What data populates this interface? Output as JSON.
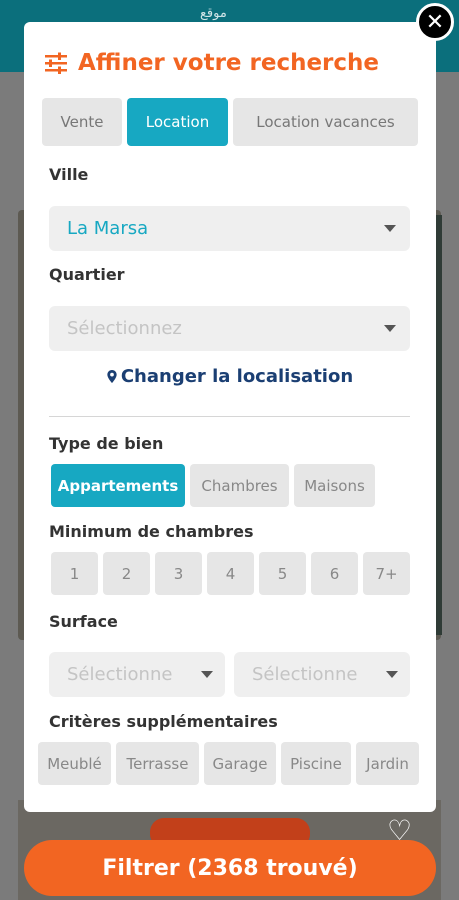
{
  "background": {
    "logo_text": "موقع"
  },
  "modal": {
    "title": "Affiner votre recherche",
    "title_icon": "sliders-icon",
    "accent": "#f26522",
    "active_color": "#17a8c2"
  },
  "tabs": [
    {
      "label": "Vente",
      "active": false
    },
    {
      "label": "Location",
      "active": true
    },
    {
      "label": "Location vacances",
      "active": false
    }
  ],
  "ville": {
    "label": "Ville",
    "value": "La Marsa"
  },
  "quartier": {
    "label": "Quartier",
    "placeholder": "Sélectionnez"
  },
  "change_location": {
    "label": "Changer la localisation",
    "icon": "map-pin-icon"
  },
  "type_de_bien": {
    "label": "Type de bien",
    "options": [
      {
        "label": "Appartements",
        "active": true
      },
      {
        "label": "Chambres",
        "active": false
      },
      {
        "label": "Maisons",
        "active": false
      }
    ]
  },
  "min_chambres": {
    "label": "Minimum de chambres",
    "options": [
      "1",
      "2",
      "3",
      "4",
      "5",
      "6",
      "7+"
    ]
  },
  "surface": {
    "label": "Surface",
    "min_placeholder": "Sélectionne",
    "max_placeholder": "Sélectionne"
  },
  "criteres": {
    "label": "Critères supplémentaires",
    "options": [
      "Meublé",
      "Terrasse",
      "Garage",
      "Piscine",
      "Jardin"
    ]
  },
  "filter_button": {
    "label": "Filtrer (2368 trouvé)"
  }
}
